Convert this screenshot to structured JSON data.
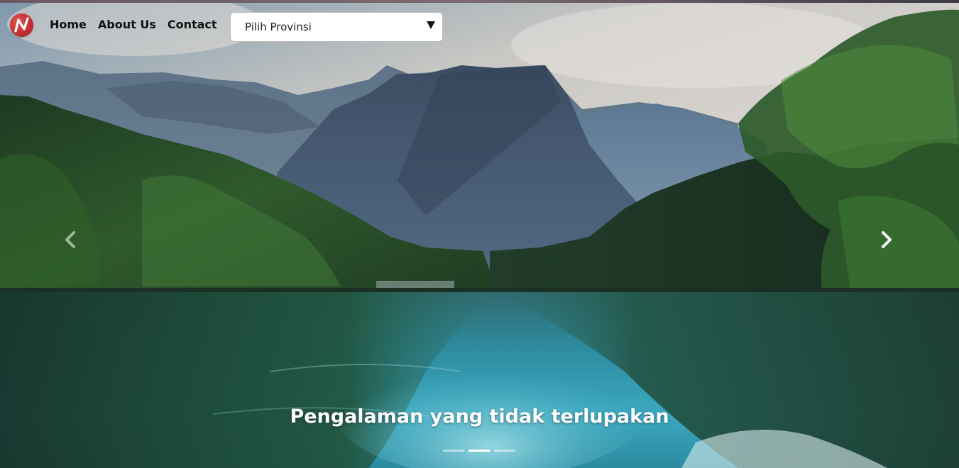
{
  "nav": {
    "links": [
      "Home",
      "About Us",
      "Contact"
    ],
    "province_select": {
      "value": "Pilih Provinsi"
    }
  },
  "hero": {
    "caption": "Pengalaman yang tidak terlupakan",
    "indicators": {
      "count": 3,
      "active_index": 1
    }
  },
  "colors": {
    "logo": "#c62f33",
    "text_nav": "#111111",
    "caption": "#ffffff"
  },
  "icons": {
    "prev": "chevron-left-icon",
    "next": "chevron-right-icon",
    "dropdown": "triangle-down-icon"
  }
}
